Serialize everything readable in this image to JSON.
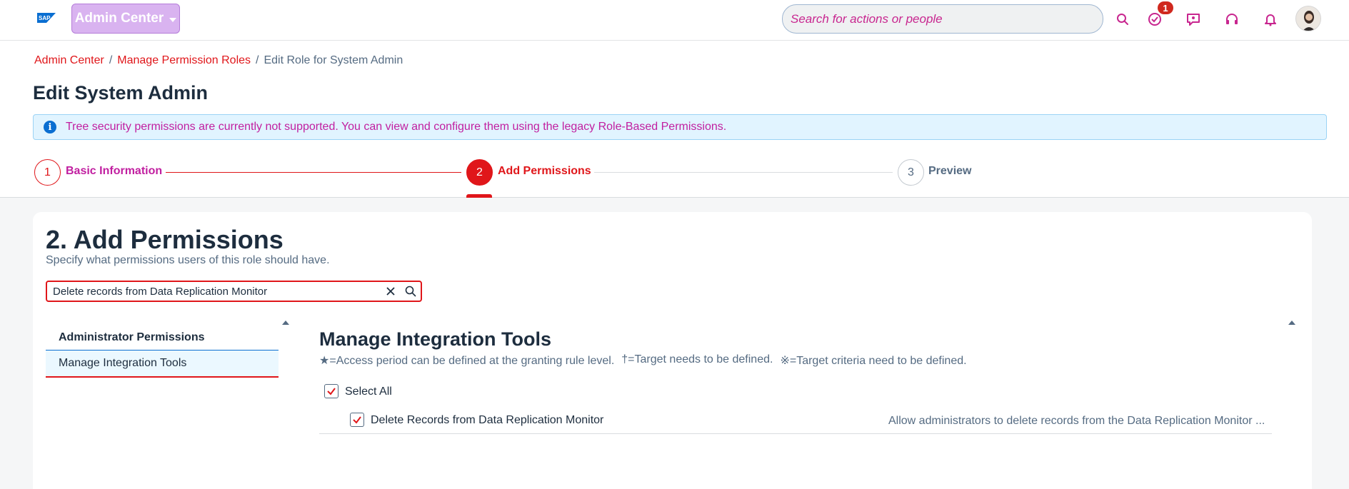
{
  "shell": {
    "logo": "SAP",
    "admin_center_label": "Admin Center",
    "search_placeholder": "Search for actions or people",
    "notification_count": "1",
    "icons": [
      "search-icon",
      "approval-check-icon",
      "chat-icon",
      "headset-icon",
      "bell-icon"
    ]
  },
  "breadcrumb": {
    "items": [
      "Admin Center",
      "Manage Permission Roles"
    ],
    "current": "Edit Role for System Admin",
    "separator": "/"
  },
  "page_title": "Edit System Admin",
  "info_message": "Tree security permissions are currently not supported. You can view and configure them using the legacy Role-Based Permissions.",
  "wizard": {
    "steps": [
      {
        "number": "1",
        "label": "Basic Information",
        "state": "completed"
      },
      {
        "number": "2",
        "label": "Add Permissions",
        "state": "active"
      },
      {
        "number": "3",
        "label": "Preview",
        "state": "upcoming"
      }
    ]
  },
  "section": {
    "title": "2. Add Permissions",
    "subtitle": "Specify what permissions users of this role should have.",
    "filter_value": "Delete records from Data Replication Monitor"
  },
  "nav": {
    "heading": "Administrator Permissions",
    "items": [
      {
        "label": "Manage Integration Tools",
        "selected": true
      }
    ]
  },
  "detail": {
    "title": "Manage Integration Tools",
    "legend": [
      "★=Access period can be defined at the granting rule level.",
      "†=Target needs to be defined.",
      "※=Target criteria need to be defined."
    ],
    "select_all_label": "Select All",
    "select_all_checked": true,
    "permissions": [
      {
        "label": "Delete Records from Data Replication Monitor",
        "description": "Allow administrators to delete records from the Data Replication Monitor ...",
        "checked": true
      }
    ]
  },
  "colors": {
    "accent_red": "#e0161a",
    "magenta": "#c11fa0",
    "admin_button_bg": "#d9b3f0",
    "info_bg": "#e1f4ff"
  }
}
